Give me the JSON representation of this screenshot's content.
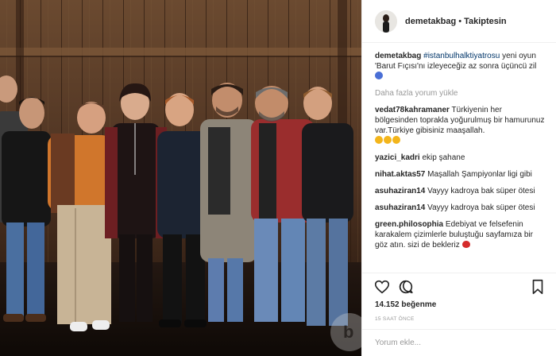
{
  "post": {
    "author": "demetakbag",
    "separator": "•",
    "follow_status": "Takiptesin"
  },
  "comments": {
    "caption": {
      "user": "demetakbag",
      "hashtag": "#istanbulhalktiyatrosu",
      "text": " yeni oyun 'Barut Fıçısı'nı izleyeceğiz az sonra üçüncü zil"
    },
    "load_more": "Daha fazla yorum yükle",
    "items": [
      {
        "user": "vedat78kahramaner",
        "text": " Türkiyenin her bölgesinden toprakla yoğurulmuş bir hamurunuz var.Türkiye gibisiniz maaşallah."
      },
      {
        "user": "yazici_kadri",
        "text": " ekip şahane"
      },
      {
        "user": "nihat.aktas57",
        "text": " Maşallah Şampiyonlar ligi gibi"
      },
      {
        "user": "asuhaziran14",
        "text": " Vayyy kadroya bak süper ötesi"
      },
      {
        "user": "asuhaziran14",
        "text": " Vayyy kadroya bak süper ötesi"
      },
      {
        "user": "green.philosophia",
        "text": " Edebiyat ve felsefenin karakalem çizimlerle buluştuğu sayfamıza bir göz atın. sizi de bekleriz"
      }
    ]
  },
  "actions": {
    "likes": "14.152 beğenme",
    "timestamp": "15 SAAT ÖNCE",
    "icons": [
      "heart-icon",
      "comment-icon",
      "bookmark-icon"
    ]
  },
  "add_comment": {
    "placeholder": "Yorum ekle..."
  },
  "colors": {
    "link": "#003569",
    "muted": "#999999",
    "text": "#262626",
    "border": "#efefef"
  }
}
